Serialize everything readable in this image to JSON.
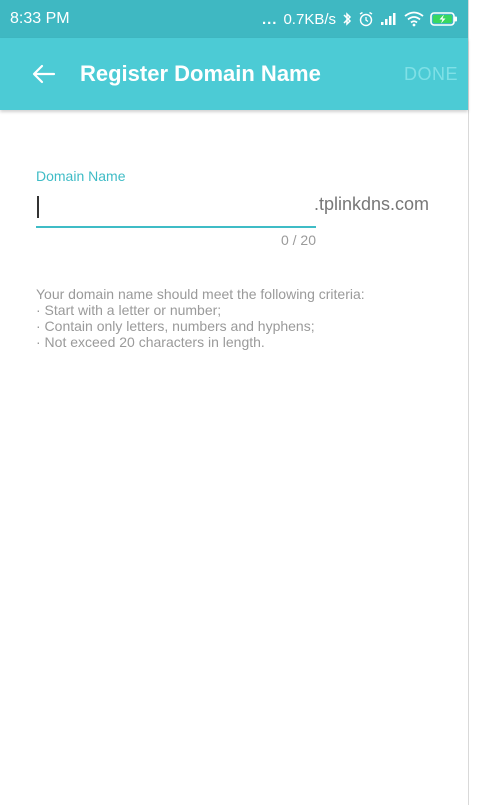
{
  "status": {
    "time": "8:33 PM",
    "dots": "...",
    "speed": "0.7KB/s",
    "icons": [
      "bluetooth-icon",
      "alarm-icon",
      "signal-icon",
      "wifi-icon",
      "battery-charging-icon"
    ]
  },
  "appbar": {
    "title": "Register Domain Name",
    "done_label": "DONE",
    "back_icon": "back-arrow-icon"
  },
  "form": {
    "label": "Domain Name",
    "value": "",
    "suffix": ".tplinkdns.com",
    "counter": "0 / 20"
  },
  "criteria": {
    "intro": "Your domain name should meet the following criteria:",
    "items": [
      "· Start with a letter or number;",
      "· Contain only letters, numbers and hyphens;",
      "· Not exceed 20 characters in length."
    ]
  },
  "colors": {
    "status_bar": "#3fb8c2",
    "app_bar": "#4ccbd5",
    "accent": "#3fbcc6"
  }
}
